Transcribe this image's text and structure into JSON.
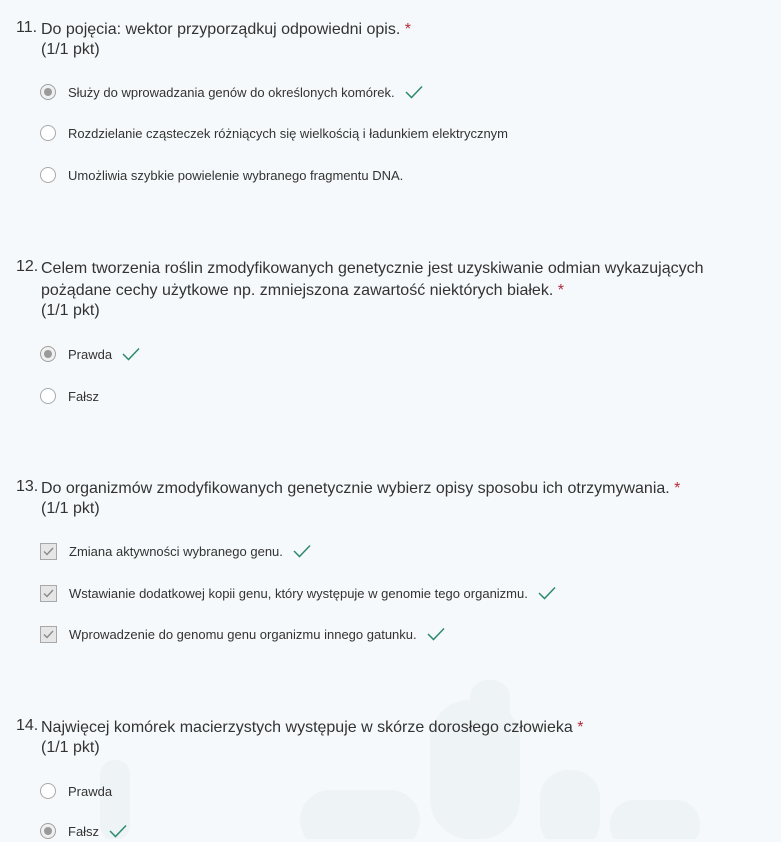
{
  "questions": [
    {
      "number": "11.",
      "text": "Do pojęcia: wektor przyporządkuj odpowiedni opis.",
      "required_mark": "*",
      "points": "(1/1 pkt)",
      "type": "radio",
      "options": [
        {
          "label": "Służy do wprowadzania genów do określonych komórek.",
          "selected": true,
          "correct": true
        },
        {
          "label": "Rozdzielanie cząsteczek różniących się wielkością i ładunkiem elektrycznym",
          "selected": false,
          "correct": false
        },
        {
          "label": "Umożliwia szybkie powielenie wybranego fragmentu DNA.",
          "selected": false,
          "correct": false
        }
      ]
    },
    {
      "number": "12.",
      "text": "Celem tworzenia roślin zmodyfikowanych genetycznie jest uzyskiwanie odmian wykazujących pożądane cechy użytkowe np. zmniejszona zawartość niektórych białek.",
      "required_mark": "*",
      "points": "(1/1 pkt)",
      "type": "radio",
      "options": [
        {
          "label": "Prawda",
          "selected": true,
          "correct": true
        },
        {
          "label": "Fałsz",
          "selected": false,
          "correct": false
        }
      ]
    },
    {
      "number": "13.",
      "text": "Do organizmów zmodyfikowanych genetycznie wybierz opisy sposobu ich otrzymywania.",
      "required_mark": "*",
      "points": "(1/1 pkt)",
      "type": "checkbox",
      "options": [
        {
          "label": "Zmiana aktywności wybranego genu.",
          "selected": true,
          "correct": true
        },
        {
          "label": "Wstawianie dodatkowej kopii genu, który występuje w genomie tego organizmu.",
          "selected": true,
          "correct": true
        },
        {
          "label": "Wprowadzenie do genomu genu organizmu innego gatunku.",
          "selected": true,
          "correct": true
        }
      ]
    },
    {
      "number": "14.",
      "text": "Najwięcej komórek macierzystych występuje w skórze dorosłego człowieka",
      "required_mark": "*",
      "points": "(1/1 pkt)",
      "type": "radio",
      "options": [
        {
          "label": "Prawda",
          "selected": false,
          "correct": false
        },
        {
          "label": "Fałsz",
          "selected": true,
          "correct": true
        }
      ]
    }
  ],
  "colors": {
    "background": "#f6f9fb",
    "required": "#b52b3a",
    "check_mark": "#2e8b6a",
    "text": "#333333"
  },
  "icons": {
    "correct": "checkmark-icon",
    "radio": "radio-button",
    "checkbox": "checkbox"
  }
}
